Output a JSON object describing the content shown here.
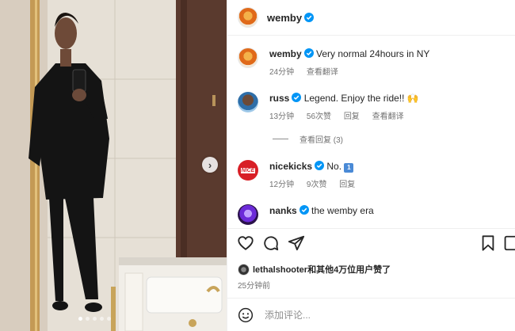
{
  "post": {
    "author": "wemby",
    "carousel_dots": 5,
    "active_dot": 1
  },
  "comments": [
    {
      "user": "wemby",
      "text": "Very normal 24hours in NY",
      "time": "24分钟",
      "translate": "查看翻译"
    },
    {
      "user": "russ",
      "text": "Legend. Enjoy the ride!! 🙌",
      "time": "13分钟",
      "likes": "56次赞",
      "reply": "回复",
      "translate": "查看翻译"
    },
    {
      "user": "nicekicks",
      "text": "No. ",
      "time": "12分钟",
      "likes": "9次赞",
      "reply": "回复"
    },
    {
      "user": "nanks",
      "text": "the wemby era"
    }
  ],
  "view_replies": "查看回复 (3)",
  "emoji_key_badge": "1",
  "nicekicks_avatar_text": "NICE",
  "liked_by": "lethalshooter和其他4万位用户赞了",
  "posted_ago": "25分钟前",
  "add_comment_placeholder": "添加评论...",
  "colors": {
    "verified": "#0095f6",
    "text": "#262626",
    "muted": "#737373"
  }
}
